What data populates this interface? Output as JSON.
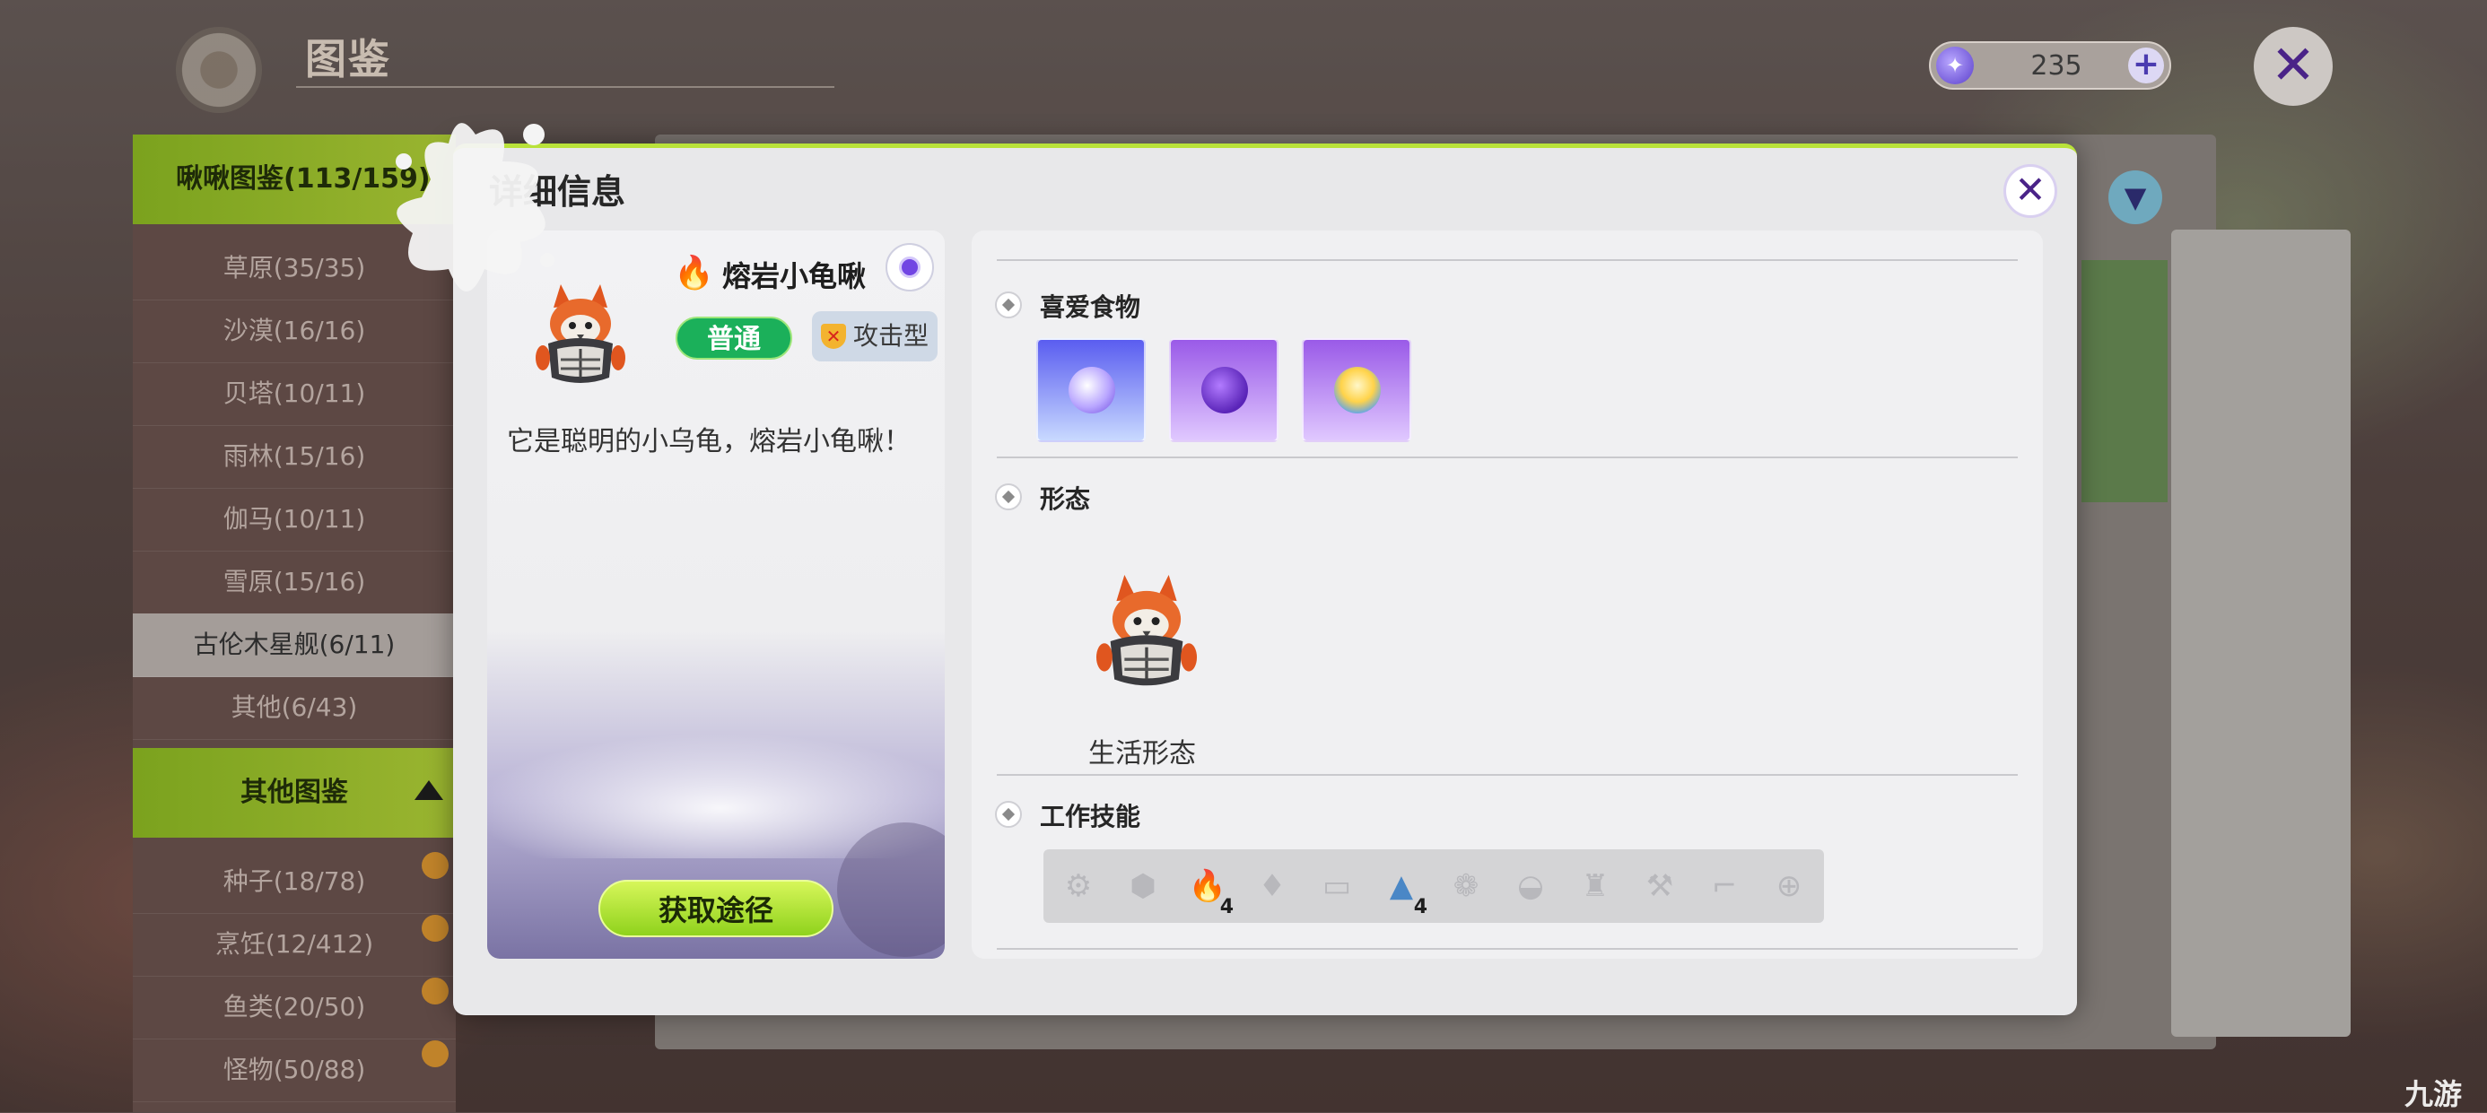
{
  "header": {
    "title": "图鉴",
    "currency_amount": "235",
    "currency_plus": "+",
    "close_symbol": "✕"
  },
  "sidebar": {
    "section1_title": "啾啾图鉴(113/159)",
    "section1_items": [
      "草原(35/35)",
      "沙漠(16/16)",
      "贝塔(10/11)",
      "雨林(15/16)",
      "伽马(10/11)",
      "雪原(15/16)",
      "古伦木星舰(6/11)",
      "其他(6/43)"
    ],
    "active_index": 6,
    "section2_title": "其他图鉴",
    "section2_items": [
      "种子(18/78)",
      "烹饪(12/412)",
      "鱼类(20/50)",
      "怪物(50/88)"
    ]
  },
  "modal": {
    "title": "详细信息",
    "close_symbol": "✕",
    "pet": {
      "name": "熔岩小龟啾",
      "element_icon": "fire-icon",
      "rarity": "普通",
      "type": "攻击型",
      "description": "它是聪明的小乌龟，熔岩小龟啾！",
      "obtain_button": "获取途径"
    },
    "sections": {
      "food_title": "喜爱食物",
      "foods": [
        {
          "icon": "blue-potion-icon",
          "color": "#5a5df0"
        },
        {
          "icon": "purple-potion-icon",
          "color": "#9a5ae8"
        },
        {
          "icon": "cream-dessert-icon",
          "color": "#9a5ae8"
        }
      ],
      "form_title": "形态",
      "form_label": "生活形态",
      "skills_title": "工作技能",
      "skills": [
        {
          "icon": "gear-icon",
          "level": ""
        },
        {
          "icon": "cube-icon",
          "level": ""
        },
        {
          "icon": "fire-icon",
          "level": "4"
        },
        {
          "icon": "crystal-icon",
          "level": ""
        },
        {
          "icon": "log-icon",
          "level": ""
        },
        {
          "icon": "tent-icon",
          "level": "4"
        },
        {
          "icon": "grape-icon",
          "level": ""
        },
        {
          "icon": "hat-icon",
          "level": ""
        },
        {
          "icon": "shirt-icon",
          "level": ""
        },
        {
          "icon": "wrench-icon",
          "level": ""
        },
        {
          "icon": "gun-icon",
          "level": ""
        },
        {
          "icon": "medicine-icon",
          "level": ""
        }
      ]
    }
  },
  "colors": {
    "accent_green": "#9ab530",
    "rarity_green": "#1bb05a",
    "close_purple": "#4a2388"
  }
}
